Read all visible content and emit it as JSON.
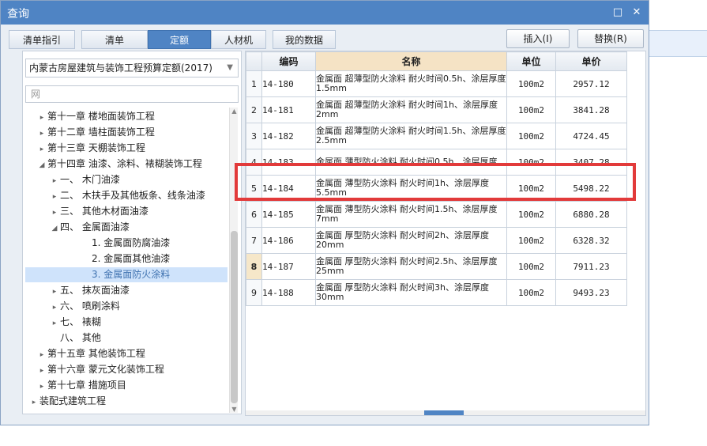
{
  "window": {
    "title": "查询"
  },
  "tabs": [
    "清单指引",
    "清单",
    "定额",
    "人材机",
    "我的数据"
  ],
  "active_tab": 2,
  "buttons": {
    "insert": "插入(I)",
    "replace": "替换(R)"
  },
  "quota_select": "内蒙古房屋建筑与装饰工程预算定额(2017)",
  "search": {
    "placeholder": "网"
  },
  "tree": [
    {
      "label": "第十一章 楼地面装饰工程",
      "level": 1,
      "caret": "right"
    },
    {
      "label": "第十二章 墙柱面装饰工程",
      "level": 1,
      "caret": "right"
    },
    {
      "label": "第十三章 天棚装饰工程",
      "level": 1,
      "caret": "right"
    },
    {
      "label": "第十四章 油漆、涂料、裱糊装饰工程",
      "level": 1,
      "caret": "down"
    },
    {
      "label": "一、 木门油漆",
      "level": 2,
      "caret": "right"
    },
    {
      "label": "二、 木扶手及其他板条、线条油漆",
      "level": 2,
      "caret": "right"
    },
    {
      "label": "三、 其他木材面油漆",
      "level": 2,
      "caret": "right"
    },
    {
      "label": "四、 金属面油漆",
      "level": 2,
      "caret": "down"
    },
    {
      "label": "1. 金属面防腐油漆",
      "level": 3,
      "caret": ""
    },
    {
      "label": "2. 金属面其他油漆",
      "level": 3,
      "caret": ""
    },
    {
      "label": "3. 金属面防火涂料",
      "level": 3,
      "caret": "",
      "selected": true
    },
    {
      "label": "五、 抹灰面油漆",
      "level": 2,
      "caret": "right"
    },
    {
      "label": "六、 喷刷涂料",
      "level": 2,
      "caret": "right"
    },
    {
      "label": "七、 裱糊",
      "level": 2,
      "caret": "right"
    },
    {
      "label": "八、 其他",
      "level": 2,
      "caret": ""
    },
    {
      "label": "第十五章 其他装饰工程",
      "level": 1,
      "caret": "right"
    },
    {
      "label": "第十六章 蒙元文化装饰工程",
      "level": 1,
      "caret": "right"
    },
    {
      "label": "第十七章 措施项目",
      "level": 1,
      "caret": "right"
    },
    {
      "label": "装配式建筑工程",
      "level": 0,
      "caret": "right"
    }
  ],
  "table": {
    "headers": {
      "code": "编码",
      "name": "名称",
      "unit": "单位",
      "price": "单价"
    },
    "current_row": 8,
    "rows": [
      {
        "idx": "1",
        "code": "14-180",
        "name": "金属面 超薄型防火涂料 耐火时间0.5h、涂层厚度1.5mm",
        "unit": "100m2",
        "price": "2957.12"
      },
      {
        "idx": "2",
        "code": "14-181",
        "name": "金属面 超薄型防火涂料 耐火时间1h、涂层厚度2mm",
        "unit": "100m2",
        "price": "3841.28"
      },
      {
        "idx": "3",
        "code": "14-182",
        "name": "金属面 超薄型防火涂料 耐火时间1.5h、涂层厚度2.5mm",
        "unit": "100m2",
        "price": "4724.45"
      },
      {
        "idx": "4",
        "code": "14-183",
        "name": "金属面 薄型防火涂料 耐火时间0.5h、涂层厚度",
        "unit": "100m2",
        "price": "3407.28"
      },
      {
        "idx": "5",
        "code": "14-184",
        "name": "金属面 薄型防火涂料 耐火时间1h、涂层厚度5.5mm",
        "unit": "100m2",
        "price": "5498.22"
      },
      {
        "idx": "6",
        "code": "14-185",
        "name": "金属面 薄型防火涂料 耐火时间1.5h、涂层厚度7mm",
        "unit": "100m2",
        "price": "6880.28"
      },
      {
        "idx": "7",
        "code": "14-186",
        "name": "金属面 厚型防火涂料 耐火时间2h、涂层厚度20mm",
        "unit": "100m2",
        "price": "6328.32"
      },
      {
        "idx": "8",
        "code": "14-187",
        "name": "金属面 厚型防火涂料 耐火时间2.5h、涂层厚度25mm",
        "unit": "100m2",
        "price": "7911.23"
      },
      {
        "idx": "9",
        "code": "14-188",
        "name": "金属面 厚型防火涂料 耐火时间3h、涂层厚度30mm",
        "unit": "100m2",
        "price": "9493.23"
      }
    ]
  },
  "colors": {
    "titlebar": "#4f84c4",
    "highlight": "#e23a3a",
    "selected_tree": "#cfe3fb"
  }
}
